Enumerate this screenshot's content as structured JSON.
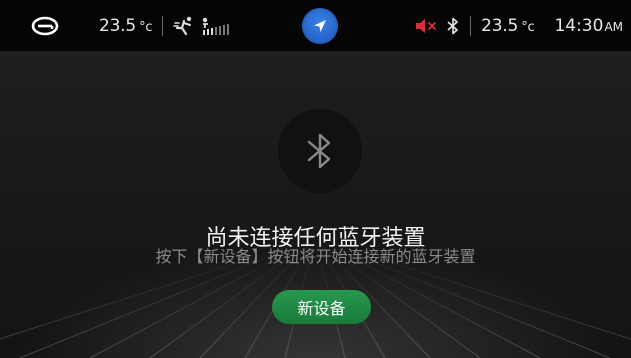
{
  "status_bar": {
    "temp_left": "23.5",
    "temp_left_unit": "°c",
    "temp_right": "23.5",
    "temp_right_unit": "°c",
    "time": "14:30",
    "time_suffix": "AM",
    "icons": [
      "car-logo-icon",
      "fan-icon",
      "fan-level-icon",
      "navigation-icon",
      "mute-icon",
      "bluetooth-icon"
    ]
  },
  "bluetooth_panel": {
    "icon": "bluetooth-icon",
    "headline": "尚未连接任何蓝牙装置",
    "subtext": "按下【新设备】按钮将开始连接新的蓝牙装置",
    "button_label": "新设备"
  },
  "colors": {
    "accent_green": "#1f8a44",
    "nav_blue": "#2a6ad0",
    "mute_red": "#d8303a"
  }
}
